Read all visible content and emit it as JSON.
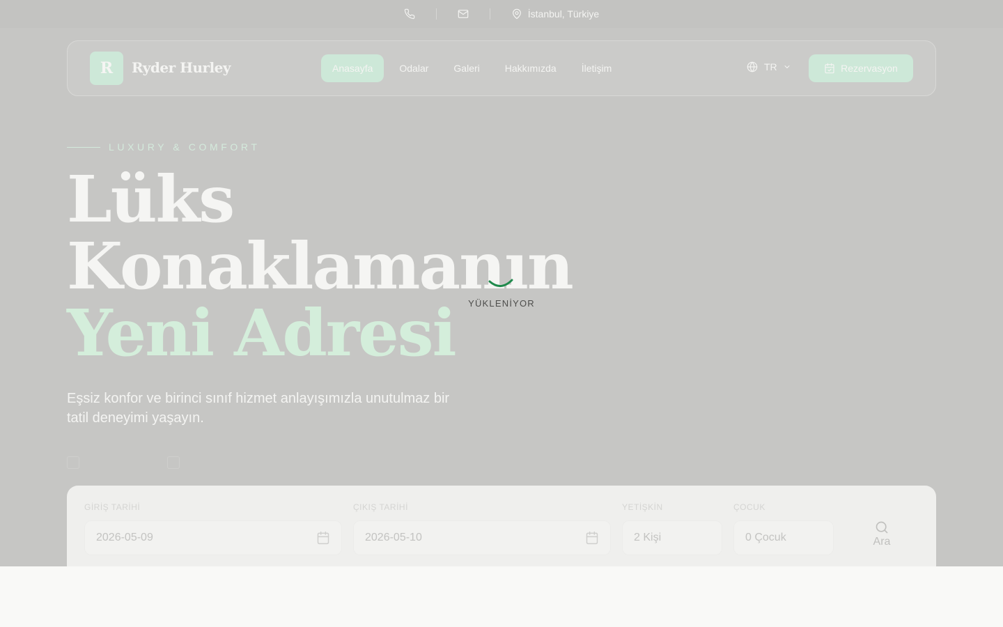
{
  "topbar": {
    "phone_icon": "phone-icon",
    "mail_icon": "mail-icon",
    "location_icon": "map-pin-icon",
    "location": "İstanbul, Türkiye"
  },
  "brand": {
    "initial": "R",
    "name": "Ryder Hurley"
  },
  "nav": {
    "items": [
      {
        "label": "Anasayfa",
        "active": true
      },
      {
        "label": "Odalar",
        "active": false
      },
      {
        "label": "Galeri",
        "active": false
      },
      {
        "label": "Hakkımızda",
        "active": false
      },
      {
        "label": "İletişim",
        "active": false
      }
    ],
    "language": "TR",
    "language_icon": "globe-icon",
    "book_label": "Rezervasyon",
    "book_icon": "calendar-check-icon"
  },
  "hero": {
    "eyebrow": "LUXURY & COMFORT",
    "title_line1": "Lüks",
    "title_line2": "Konaklamanın",
    "title_line3": "Yeni Adresi",
    "description": "Eşsiz konfor ve birinci sınıf hizmet anlayışımızla unutulmaz bir tatil deneyimi yaşayın."
  },
  "loader": {
    "label": "YÜKLENİYOR"
  },
  "search": {
    "checkin": {
      "label": "GİRİŞ TARİHİ",
      "value": "2026-05-09"
    },
    "checkout": {
      "label": "ÇIKIŞ TARİHİ",
      "value": "2026-05-10"
    },
    "adults": {
      "label": "YETİŞKİN",
      "value": "2 Kişi"
    },
    "children": {
      "label": "ÇOCUK",
      "value": "0 Çocuk"
    },
    "button_label": "Ara"
  },
  "colors": {
    "accent": "#cde8d8",
    "overlay": "#c6c6c4",
    "spinner": "#1f8a4c"
  }
}
